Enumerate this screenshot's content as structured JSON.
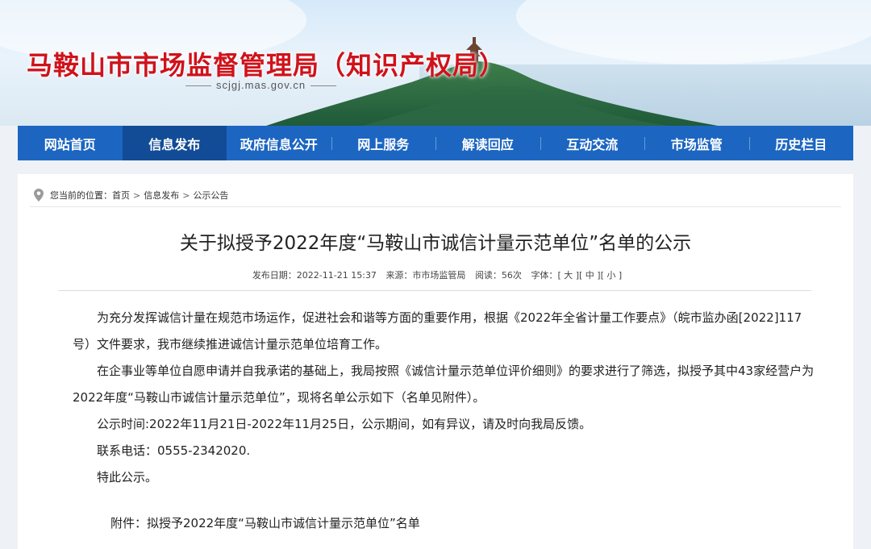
{
  "header": {
    "site_title": "马鞍山市市场监督管理局（知识产权局）",
    "domain": "scjgj.mas.gov.cn"
  },
  "nav": {
    "items": [
      {
        "label": "网站首页"
      },
      {
        "label": "信息发布"
      },
      {
        "label": "政府信息公开"
      },
      {
        "label": "网上服务"
      },
      {
        "label": "解读回应"
      },
      {
        "label": "互动交流"
      },
      {
        "label": "市场监管"
      },
      {
        "label": "历史栏目"
      }
    ],
    "active": "信息发布"
  },
  "breadcrumb": {
    "prefix": "您当前的位置：",
    "items": [
      "首页",
      "信息发布",
      "公示公告"
    ],
    "separator": ">"
  },
  "article": {
    "title": "关于拟授予2022年度“马鞍山市诚信计量示范单位”名单的公示",
    "meta": {
      "date": "发布日期：2022-11-21 15:37",
      "source": "来源：市市场监管局",
      "views": "阅读：56次",
      "font_label": "字体：",
      "font_large": "[ 大 ]",
      "font_medium": "[ 中 ]",
      "font_small": "[ 小 ]"
    },
    "paragraphs": [
      "为充分发挥诚信计量在规范市场运作，促进社会和谐等方面的重要作用，根据《2022年全省计量工作要点》（皖市监办函[2022]117号）文件要求，我市继续推进诚信计量示范单位培育工作。",
      "在企事业等单位自愿申请并自我承诺的基础上，我局按照《诚信计量示范单位评价细则》的要求进行了筛选，拟授予其中43家经营户为2022年度“马鞍山市诚信计量示范单位”，现将名单公示如下（名单见附件）。",
      "公示时间:2022年11月21日-2022年11月25日，公示期间，如有异议，请及时向我局反馈。",
      "联系电话：0555-2342020.",
      "特此公示。"
    ],
    "attachment": "附件：拟授予2022年度“马鞍山市诚信计量示范单位”名单"
  },
  "colors": {
    "title_red": "#d0121b",
    "nav_blue": "#1c66c2",
    "nav_active": "#124c97"
  }
}
